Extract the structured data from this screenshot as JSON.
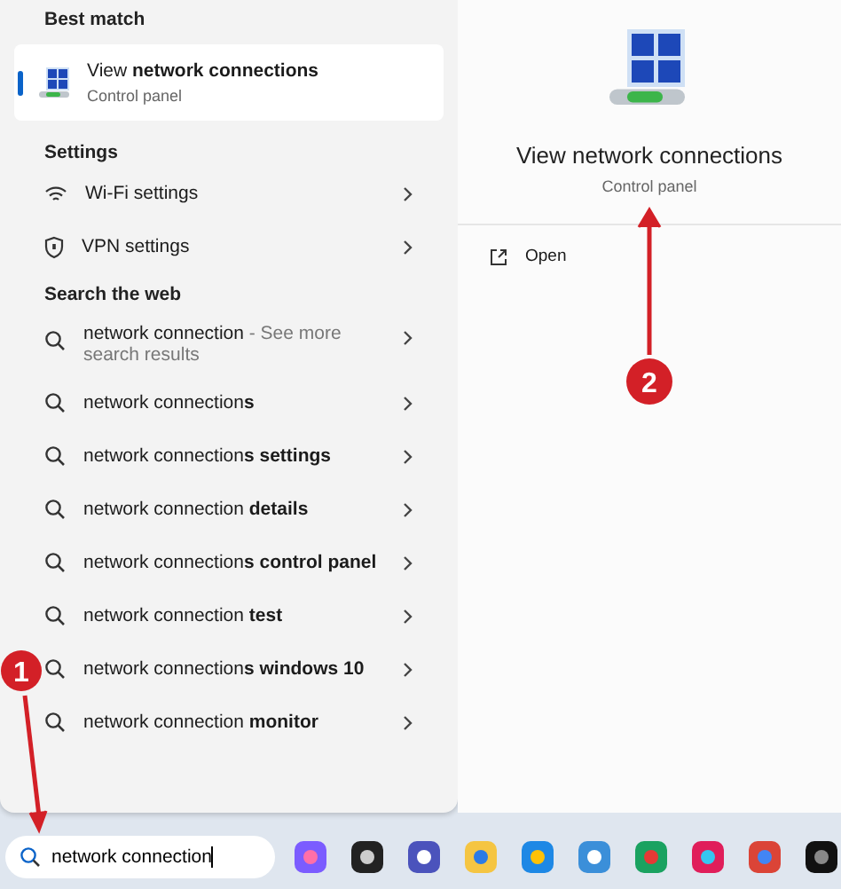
{
  "best_match": {
    "header": "Best match",
    "title": "View **network connections**",
    "subtitle": "Control panel",
    "selected": true
  },
  "settings": {
    "header": "Settings",
    "items": [
      {
        "label": "Wi-Fi settings",
        "kind": "wifi"
      },
      {
        "label": "VPN settings",
        "kind": "vpn"
      }
    ]
  },
  "web": {
    "header": "Search the web",
    "items": [
      {
        "text": "network connection",
        "note": "- See more search results"
      },
      {
        "text": "network connection**s**"
      },
      {
        "text": "network connection**s settings**"
      },
      {
        "text": "network connection **details**"
      },
      {
        "text": "network connection**s control panel**"
      },
      {
        "text": "network connection **test**"
      },
      {
        "text": "network connection**s windows 10**"
      },
      {
        "text": "network connection **monitor**"
      }
    ]
  },
  "preview": {
    "title": "View network connections",
    "subtitle": "Control panel",
    "actions": [
      "Open"
    ]
  },
  "taskbar": {
    "search_value": "network connection"
  },
  "annotations": [
    {
      "label": "1"
    },
    {
      "label": "2"
    }
  ]
}
